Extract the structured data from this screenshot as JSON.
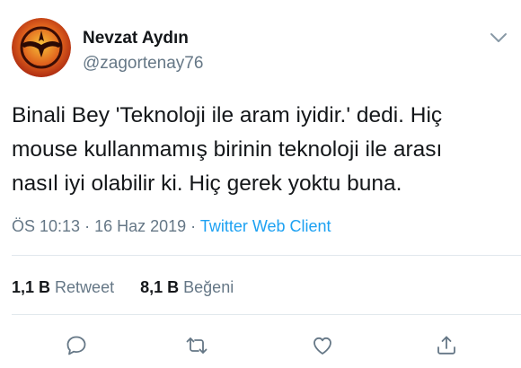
{
  "user": {
    "display_name": "Nevzat Aydın",
    "handle": "@zagortenay76",
    "avatar_icon": "zagor-logo-avatar"
  },
  "tweet": {
    "lines": [
      "Binali Bey 'Teknoloji ile aram iyidir.' dedi. Hiç",
      "mouse kullanmamış birinin teknoloji ile arası",
      "nasıl iyi olabilir ki. Hiç gerek yoktu buna."
    ]
  },
  "meta": {
    "time": "ÖS 10:13",
    "sep1": " · ",
    "date": "16 Haz 2019",
    "sep2": " · ",
    "source": "Twitter Web Client"
  },
  "stats": {
    "retweets_count": "1,1 B",
    "retweets_label": "Retweet",
    "likes_count": "8,1 B",
    "likes_label": "Beğeni"
  },
  "actions": [
    "reply-icon",
    "retweet-icon",
    "like-icon",
    "share-icon"
  ],
  "colors": {
    "text": "#14171a",
    "secondary": "#657786",
    "link": "#1da1f2",
    "divider": "#e1e8ed",
    "avatar_bg": "#c8401a"
  }
}
